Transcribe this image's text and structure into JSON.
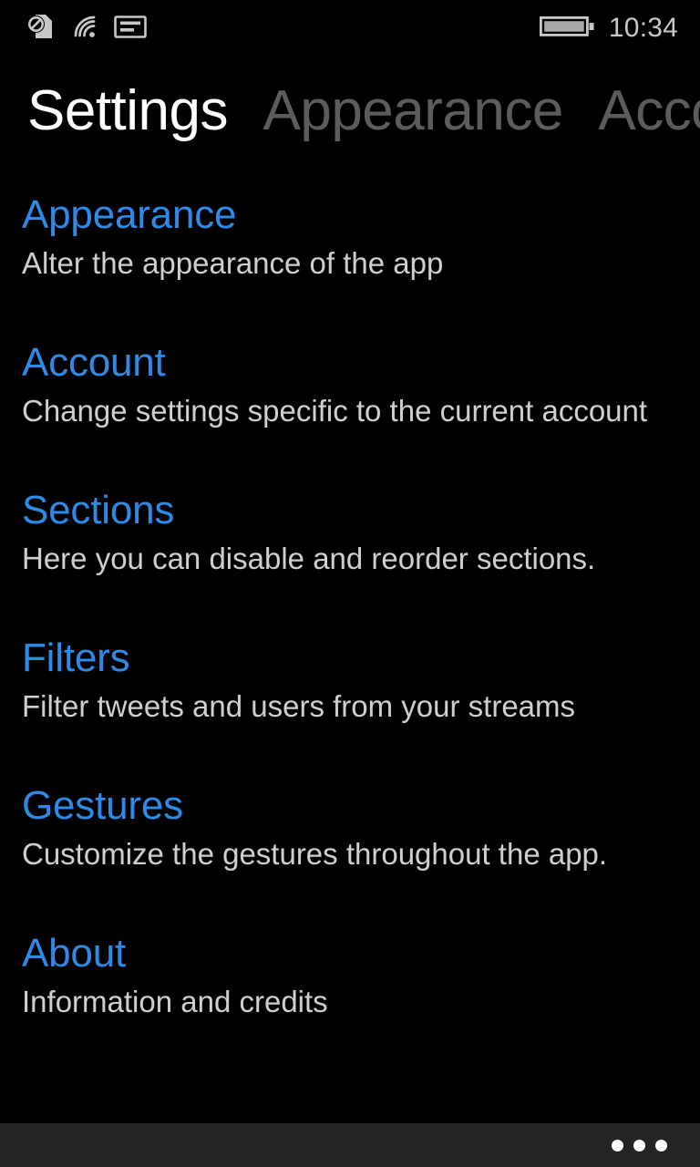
{
  "status_bar": {
    "icons": [
      {
        "name": "no-sim-icon",
        "label": "No SIM"
      },
      {
        "name": "wifi-icon",
        "label": "Wi-Fi"
      },
      {
        "name": "sim-card-icon",
        "label": "SIM"
      }
    ],
    "battery": {
      "name": "battery-icon",
      "label": "Battery",
      "level_percent": 85
    },
    "clock": "10:34"
  },
  "pivot": {
    "items": [
      {
        "label": "Settings",
        "active": true
      },
      {
        "label": "Appearance",
        "active": false
      },
      {
        "label": "Accoun",
        "active": false
      }
    ]
  },
  "settings": {
    "items": [
      {
        "title": "Appearance",
        "subtitle": "Alter the appearance of the app"
      },
      {
        "title": "Account",
        "subtitle": "Change settings specific to the current account"
      },
      {
        "title": "Sections",
        "subtitle": "Here you can disable and reorder sections."
      },
      {
        "title": "Filters",
        "subtitle": "Filter tweets and users from your streams"
      },
      {
        "title": "Gestures",
        "subtitle": "Customize the gestures throughout the app."
      },
      {
        "title": "About",
        "subtitle": "Information and credits"
      }
    ]
  },
  "app_bar": {
    "more_button": {
      "name": "more-icon",
      "label": "more"
    }
  },
  "colors": {
    "background": "#000000",
    "accent": "#2e8ae6",
    "subtitle": "#cfcfcf",
    "pivot_active": "#ffffff",
    "pivot_inactive": "#5c5c5c",
    "status_icon": "#c8c8c8",
    "app_bar": "#222425"
  }
}
